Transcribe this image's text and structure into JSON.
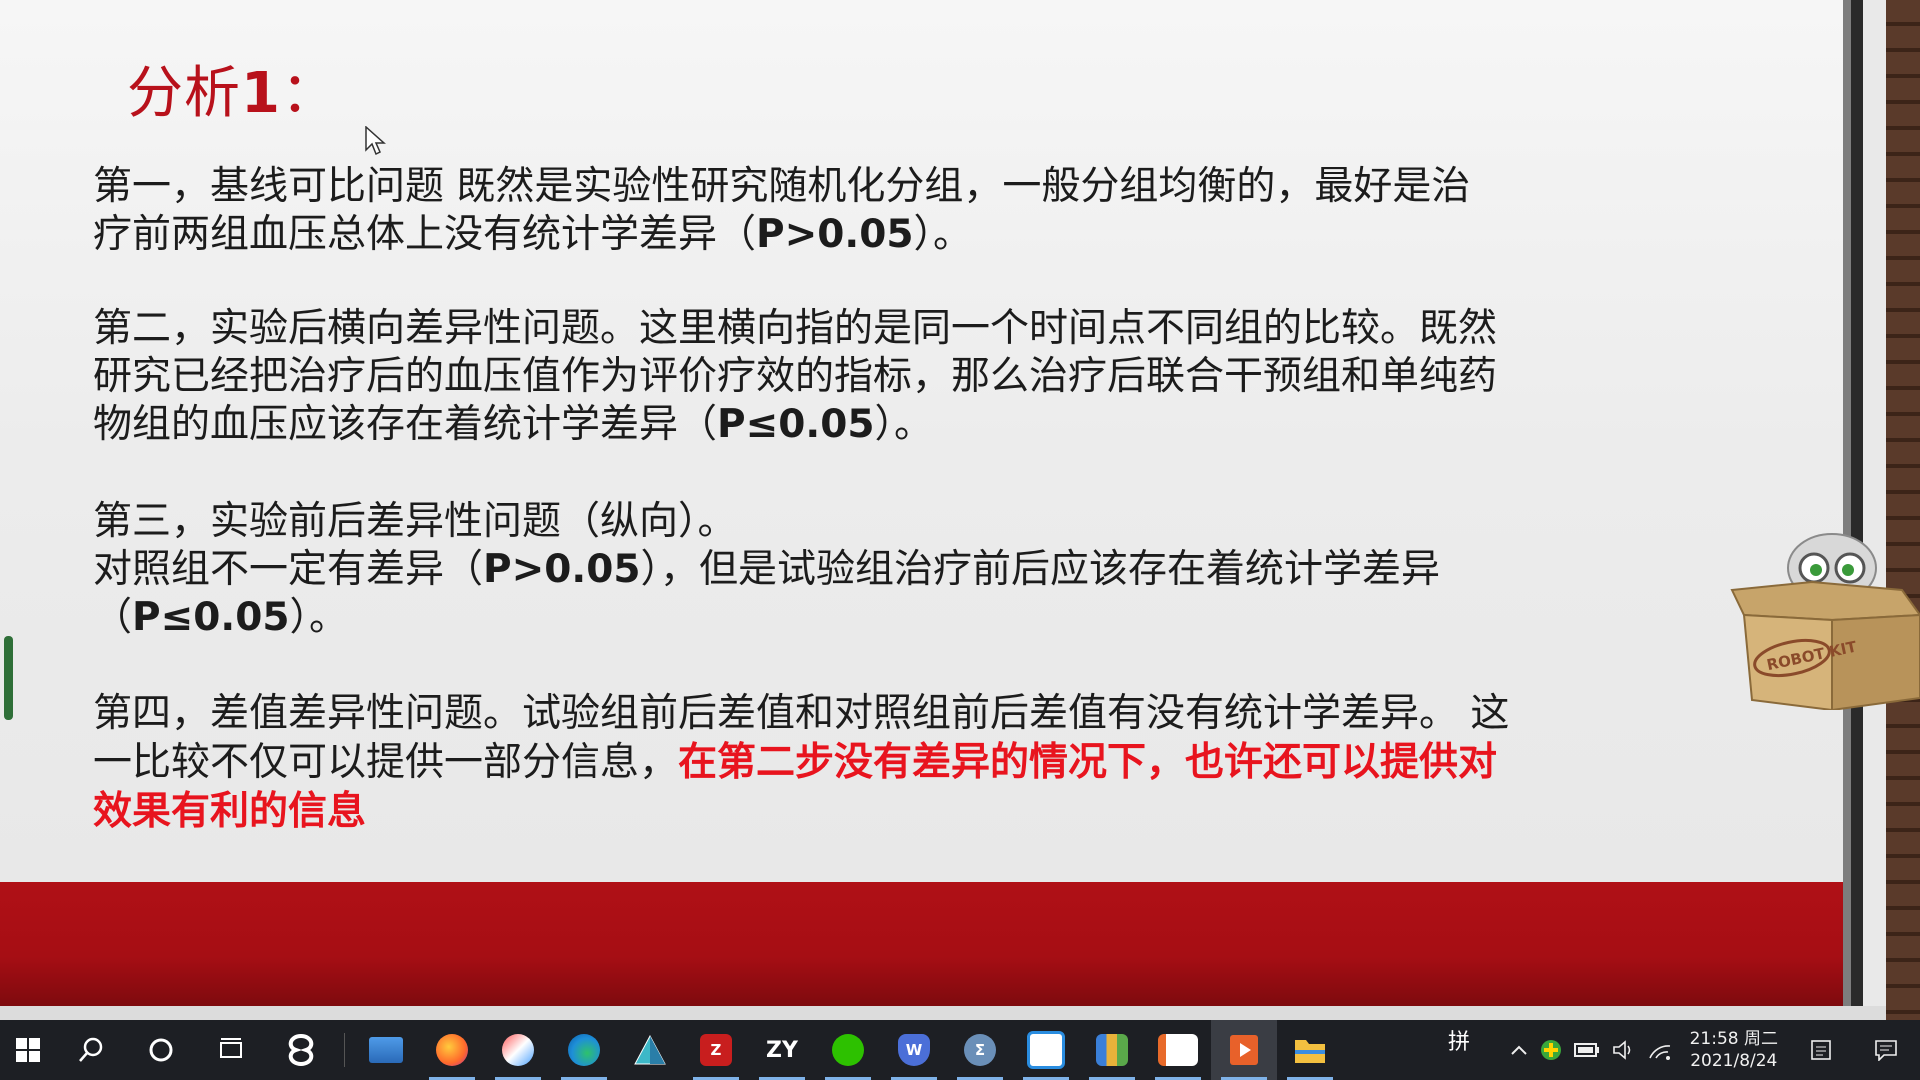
{
  "slide": {
    "title_text": "分析",
    "title_num": "1",
    "title_colon": "：",
    "para1": {
      "line1": "第一，基线可比问题  既然是实验性研究随机化分组，一般分组均衡的，最好是治",
      "line2_a": "疗前两组血压总体上没有统计学差异（",
      "line2_b": "P>0.05",
      "line2_c": "）。"
    },
    "para2": {
      "line1": "第二，实验后横向差异性问题。这里横向指的是同一个时间点不同组的比较。既然",
      "line2": "研究已经把治疗后的血压值作为评价疗效的指标，那么治疗后联合干预组和单纯药",
      "line3_a": "物组的血压应该存在着统计学差异（",
      "line3_b": "P≤0.05",
      "line3_c": "）。"
    },
    "para3": {
      "line1": "第三，实验前后差异性问题（纵向）。",
      "line2_a": "对照组不一定有差异（",
      "line2_b": "P>0.05",
      "line2_c": "），但是试验组治疗前后应该存在着统计学差异",
      "line3_a": "（",
      "line3_b": "P≤0.05",
      "line3_c": "）。"
    },
    "para4": {
      "line1": "第四，差值差异性问题。试验组前后差值和对照组前后差值有没有统计学差异。 这",
      "line2_a": "一比较不仅可以提供一部分信息，",
      "line2_red": "在第二步没有差异的情况下，也许还可以提供对",
      "line3_red": "效果有利的信息"
    },
    "robot_box_label": "ROBOT KIT"
  },
  "taskbar": {
    "ime_label": "拼",
    "clock_time": "21:58 周二",
    "clock_date": "2021/8/24",
    "apps": [
      "start",
      "search",
      "cortana",
      "task-view",
      "app-swirl",
      "desktop-pc",
      "firefox",
      "app-brush",
      "edge",
      "app-prism",
      "app-z",
      "zy",
      "wechat",
      "app-w-shield",
      "app-sigma",
      "app-cube",
      "app-files",
      "app-office",
      "app-player",
      "file-explorer"
    ],
    "zy_label": "ZY",
    "z_label": "Z",
    "w_label": "W",
    "sigma_label": "Σ"
  },
  "colors": {
    "title_red": "#b8111b",
    "highlight_red": "#e8141e",
    "footer_band": "#a60e14",
    "taskbar": "#1d1f24"
  }
}
